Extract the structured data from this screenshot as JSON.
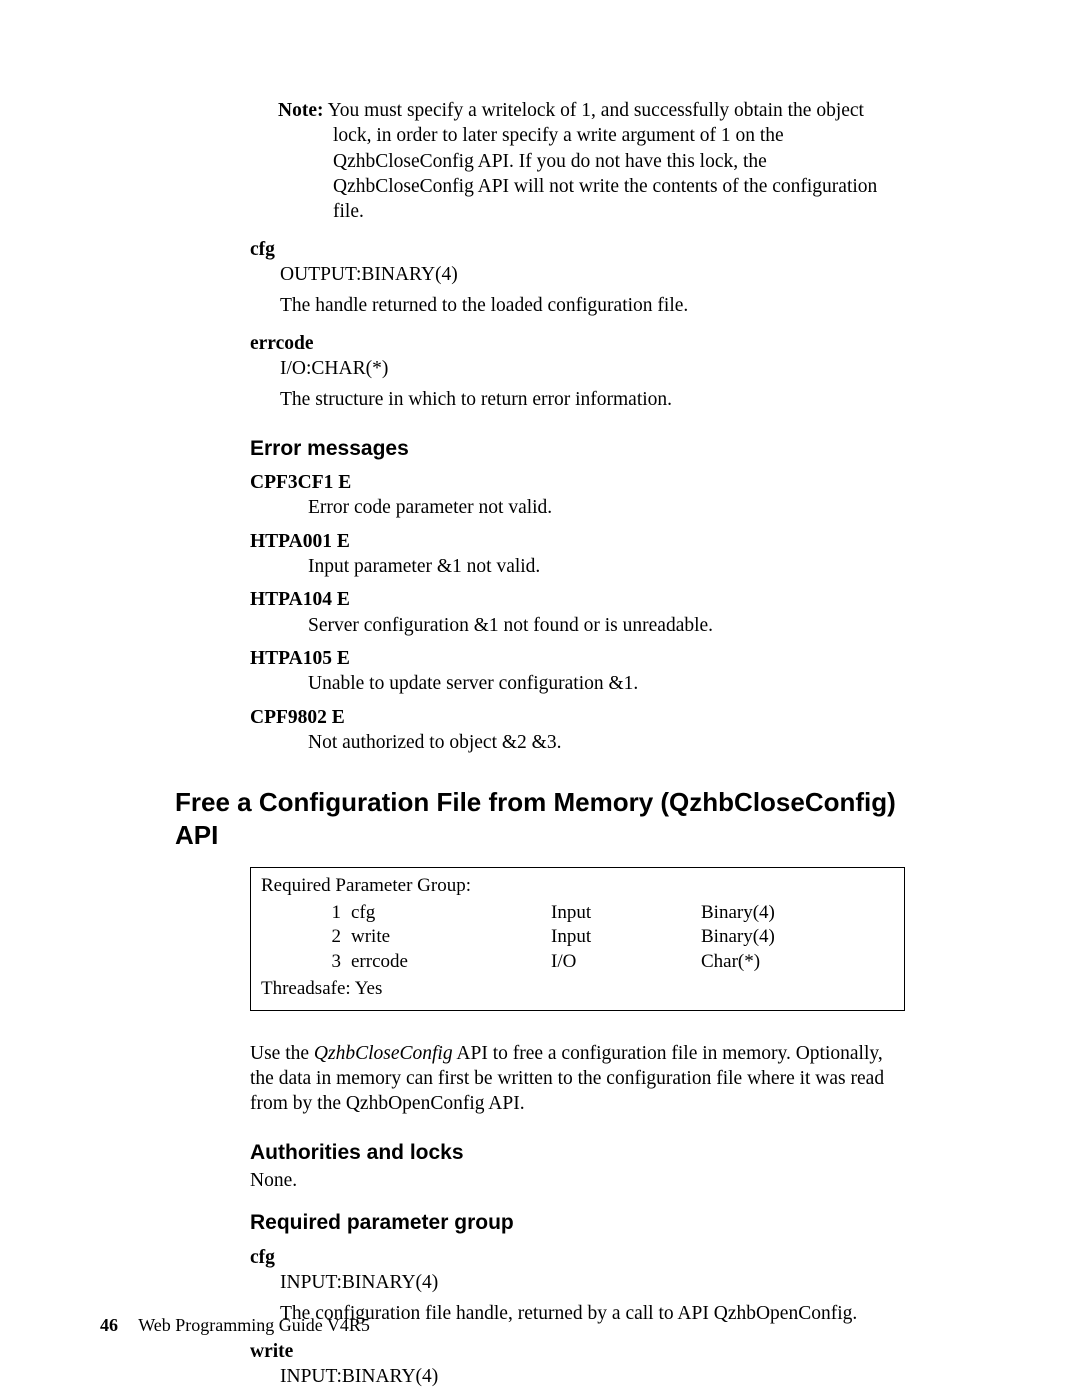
{
  "note": {
    "label": "Note:",
    "text": "You must specify a writelock of 1, and successfully obtain the object lock, in order to later specify a write argument of 1 on the QzhbCloseConfig API. If you do not have this lock, the QzhbCloseConfig API will not write the contents of the configuration file."
  },
  "params_top": {
    "cfg": {
      "name": "cfg",
      "type": "OUTPUT:BINARY(4)",
      "desc": "The handle returned to the loaded configuration file."
    },
    "errcode": {
      "name": "errcode",
      "type": "I/O:CHAR(*)",
      "desc": "The structure in which to return error information."
    }
  },
  "error_section": {
    "heading": "Error messages",
    "items": [
      {
        "code": "CPF3CF1 E",
        "text": "Error code parameter not valid."
      },
      {
        "code": "HTPA001 E",
        "text": "Input parameter &1 not valid."
      },
      {
        "code": "HTPA104 E",
        "text": "Server configuration &1 not found or is unreadable."
      },
      {
        "code": "HTPA105 E",
        "text": "Unable to update server configuration &1."
      },
      {
        "code": "CPF9802 E",
        "text": "Not authorized to object &2 &3."
      }
    ]
  },
  "api_heading": "Free a Configuration File from Memory (QzhbCloseConfig) API",
  "param_box": {
    "title": "Required Parameter Group:",
    "rows": [
      {
        "num": "1",
        "name": "cfg",
        "dir": "Input",
        "type": "Binary(4)"
      },
      {
        "num": "2",
        "name": "write",
        "dir": "Input",
        "type": "Binary(4)"
      },
      {
        "num": "3",
        "name": "errcode",
        "dir": "I/O",
        "type": "Char(*)"
      }
    ],
    "threadsafe": "Threadsafe: Yes"
  },
  "api_desc": {
    "prefix": "Use the ",
    "api_name": "QzhbCloseConfig",
    "suffix": " API to free a configuration file in memory. Optionally, the data in memory can first be written to the configuration file where it was read from by the QzhbOpenConfig API."
  },
  "auth": {
    "heading": "Authorities and locks",
    "text": "None."
  },
  "req_group": {
    "heading": "Required parameter group",
    "cfg": {
      "name": "cfg",
      "type": "INPUT:BINARY(4)",
      "desc": "The configuration file handle, returned by a call to API QzhbOpenConfig."
    },
    "write": {
      "name": "write",
      "type": "INPUT:BINARY(4)"
    }
  },
  "footer": {
    "page": "46",
    "title": "Web Programming Guide V4R5"
  }
}
